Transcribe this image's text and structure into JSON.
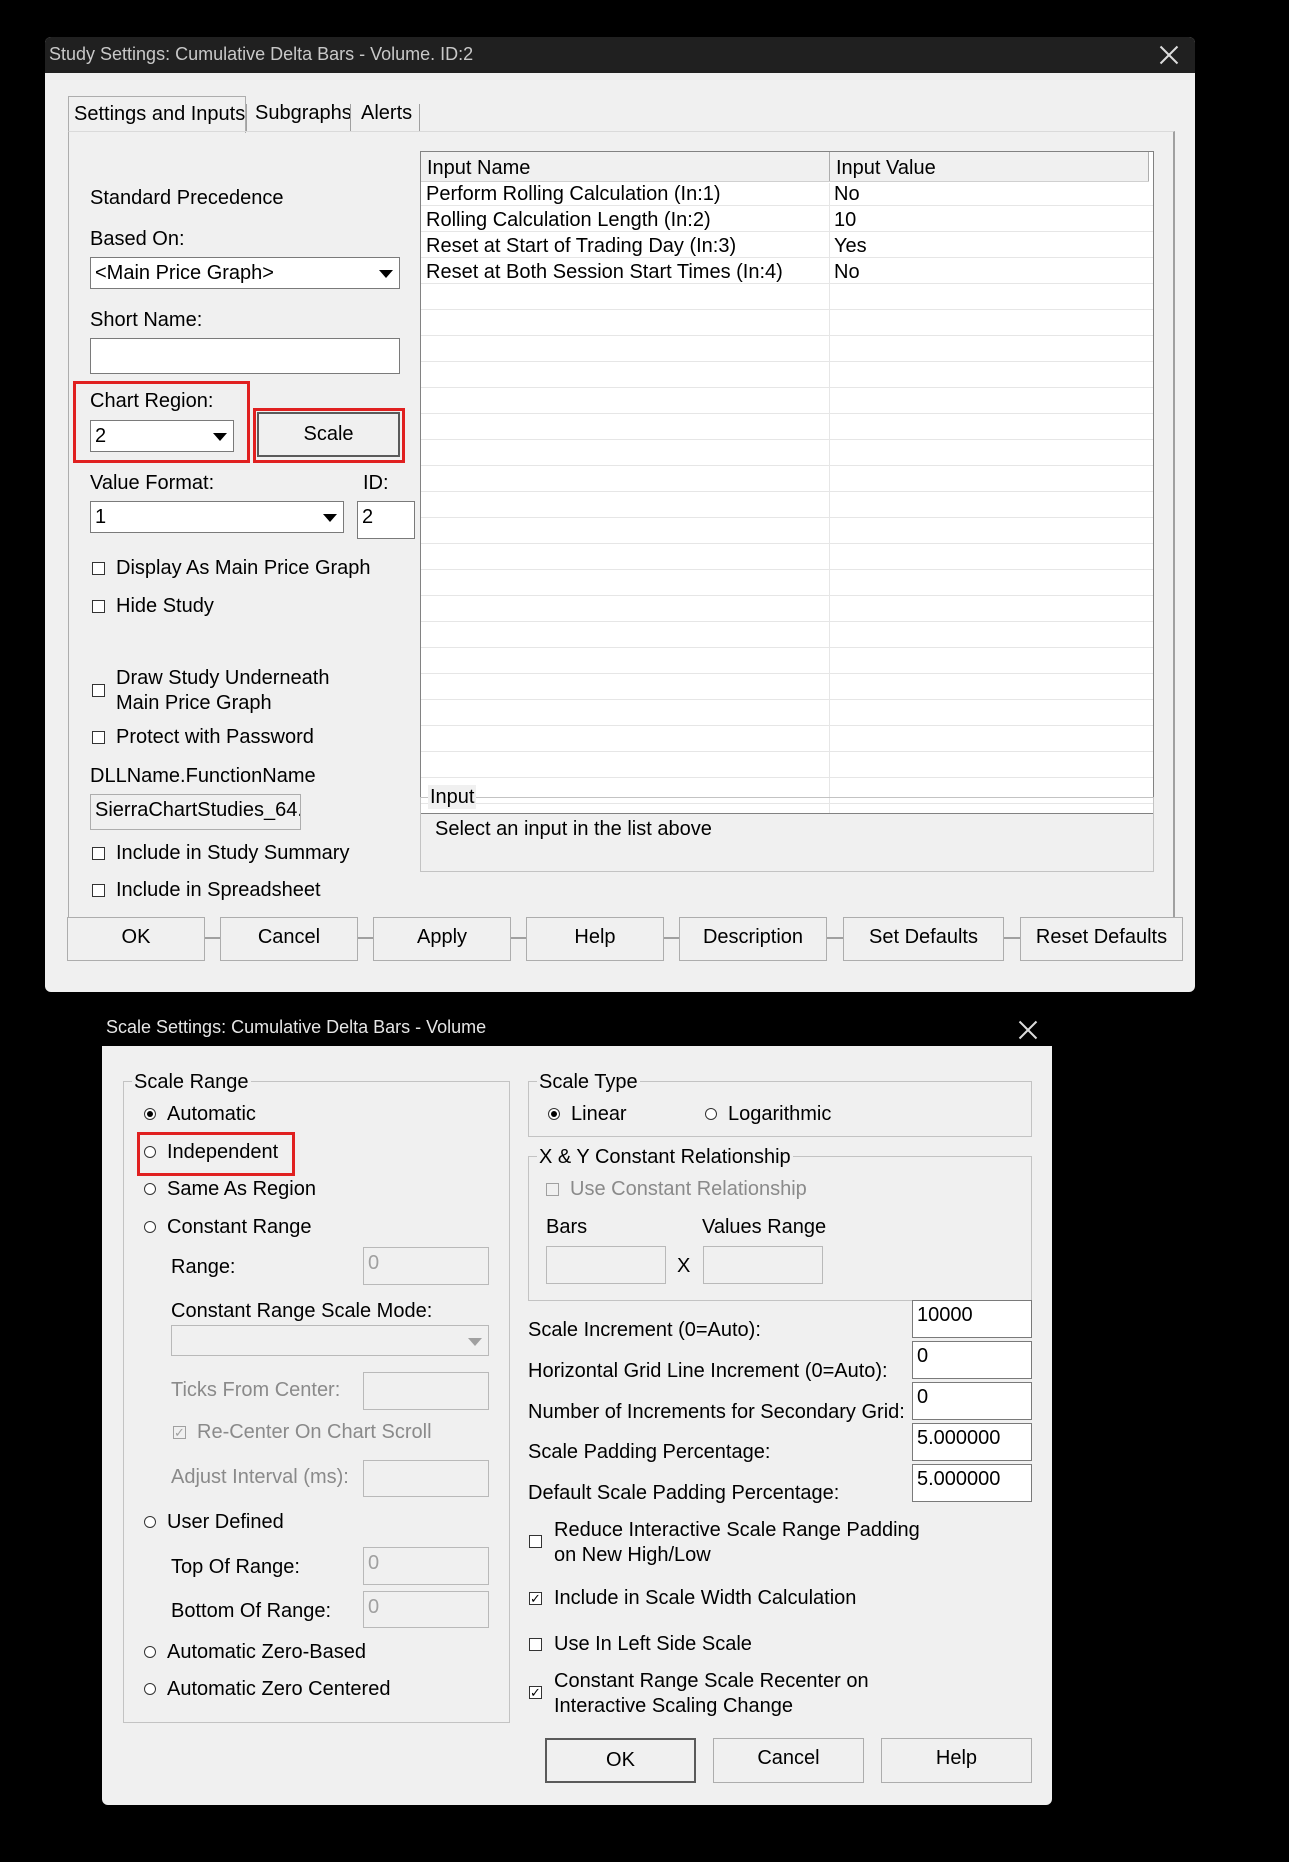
{
  "study_window": {
    "title": "Study Settings: Cumulative Delta Bars - Volume. ID:2",
    "tabs": [
      "Settings and Inputs",
      "Subgraphs",
      "Alerts"
    ],
    "standard_precedence": "Standard Precedence",
    "based_on_label": "Based On:",
    "based_on_value": "<Main Price Graph>",
    "short_name_label": "Short Name:",
    "short_name_value": "",
    "chart_region_label": "Chart Region:",
    "chart_region_value": "2",
    "scale_button": "Scale",
    "value_format_label": "Value Format:",
    "value_format_value": "1",
    "id_label": "ID:",
    "id_value": "2",
    "checkboxes": [
      {
        "label": "Display As Main Price Graph",
        "checked": false
      },
      {
        "label": "Hide Study",
        "checked": false
      },
      {
        "label": "Draw Study Underneath",
        "label2": "Main Price Graph",
        "checked": false
      },
      {
        "label": "Protect with Password",
        "checked": false
      }
    ],
    "dll_label": "DLLName.FunctionName",
    "dll_value": "SierraChartStudies_64.",
    "checkboxes2": [
      {
        "label": "Include in Study Summary",
        "checked": false
      },
      {
        "label": "Include in Spreadsheet",
        "checked": false
      }
    ],
    "input_table": {
      "columns": [
        "Input Name",
        "Input Value"
      ],
      "rows": [
        {
          "name": "Perform Rolling Calculation   (In:1)",
          "value": "No"
        },
        {
          "name": "Rolling Calculation Length   (In:2)",
          "value": "10"
        },
        {
          "name": "Reset at Start of Trading Day   (In:3)",
          "value": "Yes"
        },
        {
          "name": "Reset at Both Session Start Times   (In:4)",
          "value": "No"
        }
      ]
    },
    "input_group_label": "Input",
    "input_hint": "Select an input in the list above",
    "buttons": [
      "OK",
      "Cancel",
      "Apply",
      "Help",
      "Description",
      "Set Defaults",
      "Reset Defaults"
    ]
  },
  "scale_window": {
    "title": "Scale Settings: Cumulative Delta Bars - Volume",
    "scale_range_label": "Scale Range",
    "range_options": {
      "automatic": "Automatic",
      "independent": "Independent",
      "same_as_region": "Same As Region",
      "constant_range": "Constant Range",
      "user_defined": "User Defined",
      "auto_zero_based": "Automatic Zero-Based",
      "auto_zero_centered": "Automatic Zero Centered"
    },
    "selected_range": "Automatic",
    "range_label": "Range:",
    "range_value": "0",
    "crs_mode_label": "Constant Range Scale Mode:",
    "ticks_from_center_label": "Ticks From Center:",
    "recenter_label": "Re-Center On Chart Scroll",
    "adjust_interval_label": "Adjust Interval (ms):",
    "top_of_range_label": "Top Of Range:",
    "top_of_range_value": "0",
    "bottom_of_range_label": "Bottom Of Range:",
    "bottom_of_range_value": "0",
    "scale_type_label": "Scale Type",
    "scale_type_linear": "Linear",
    "scale_type_log": "Logarithmic",
    "selected_scale_type": "Linear",
    "xy_label": "X & Y Constant Relationship",
    "use_constant_label": "Use Constant Relationship",
    "bars_label": "Bars",
    "values_range_label": "Values Range",
    "x_sep": "X",
    "fields": [
      {
        "label": "Scale Increment (0=Auto):",
        "value": "10000"
      },
      {
        "label": "Horizontal Grid Line Increment (0=Auto):",
        "value": "0"
      },
      {
        "label": "Number of Increments for Secondary Grid:",
        "value": "0"
      },
      {
        "label": "Scale Padding Percentage:",
        "value": "5.000000"
      },
      {
        "label": "Default Scale Padding Percentage:",
        "value": "5.000000"
      }
    ],
    "reduce_padding_label1": "Reduce Interactive Scale Range Padding",
    "reduce_padding_label2": "on New High/Low",
    "include_width_label": "Include in Scale Width Calculation",
    "left_side_label": "Use In Left Side Scale",
    "recenter_interactive_label1": "Constant Range Scale Recenter on",
    "recenter_interactive_label2": "Interactive Scaling Change",
    "buttons": [
      "OK",
      "Cancel",
      "Help"
    ]
  }
}
